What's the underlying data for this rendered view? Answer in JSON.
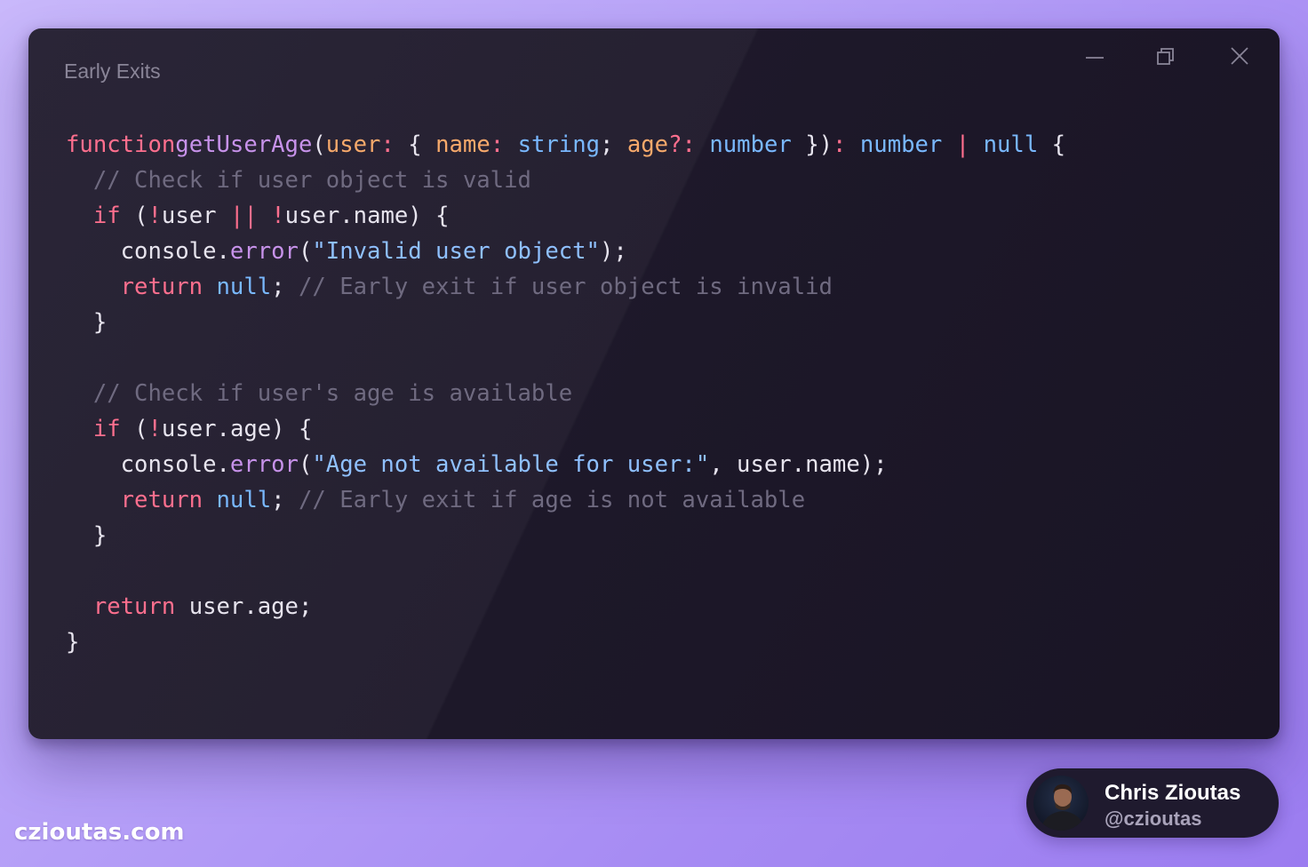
{
  "window": {
    "title": "Early Exits"
  },
  "code": {
    "lines": [
      [
        [
          "kw",
          "function"
        ],
        [
          "",
          ""
        ],
        [
          "fn",
          "getUserAge"
        ],
        [
          "",
          "("
        ],
        [
          "pr",
          "user"
        ],
        [
          "kw",
          ":"
        ],
        [
          "",
          " { "
        ],
        [
          "pr",
          "name"
        ],
        [
          "kw",
          ":"
        ],
        [
          "",
          " "
        ],
        [
          "ty",
          "string"
        ],
        [
          "",
          "; "
        ],
        [
          "pr",
          "age"
        ],
        [
          "kw",
          "?:"
        ],
        [
          "",
          " "
        ],
        [
          "ty",
          "number"
        ],
        [
          "",
          " })"
        ],
        [
          "kw",
          ":"
        ],
        [
          "",
          " "
        ],
        [
          "ty",
          "number"
        ],
        [
          "",
          " "
        ],
        [
          "kw",
          "|"
        ],
        [
          "",
          " "
        ],
        [
          "ty",
          "null"
        ],
        [
          "",
          " {"
        ]
      ],
      [
        [
          "",
          "  "
        ],
        [
          "cm",
          "// Check if user object is valid"
        ]
      ],
      [
        [
          "",
          "  "
        ],
        [
          "kw",
          "if"
        ],
        [
          "",
          " ("
        ],
        [
          "kw",
          "!"
        ],
        [
          "",
          "user "
        ],
        [
          "kw",
          "||"
        ],
        [
          "",
          " "
        ],
        [
          "kw",
          "!"
        ],
        [
          "",
          "user.name) {"
        ]
      ],
      [
        [
          "",
          "    console."
        ],
        [
          "fn",
          "error"
        ],
        [
          "",
          "("
        ],
        [
          "st",
          "\"Invalid user object\""
        ],
        [
          "",
          ");"
        ]
      ],
      [
        [
          "",
          "    "
        ],
        [
          "kw",
          "return"
        ],
        [
          "",
          " "
        ],
        [
          "ty",
          "null"
        ],
        [
          "",
          "; "
        ],
        [
          "cm",
          "// Early exit if user object is invalid"
        ]
      ],
      [
        [
          "",
          "  }"
        ]
      ],
      [
        [
          "",
          ""
        ]
      ],
      [
        [
          "",
          "  "
        ],
        [
          "cm",
          "// Check if user's age is available"
        ]
      ],
      [
        [
          "",
          "  "
        ],
        [
          "kw",
          "if"
        ],
        [
          "",
          " ("
        ],
        [
          "kw",
          "!"
        ],
        [
          "",
          "user.age) {"
        ]
      ],
      [
        [
          "",
          "    console."
        ],
        [
          "fn",
          "error"
        ],
        [
          "",
          "("
        ],
        [
          "st",
          "\"Age not available for user:\""
        ],
        [
          "",
          ", user.name);"
        ]
      ],
      [
        [
          "",
          "    "
        ],
        [
          "kw",
          "return"
        ],
        [
          "",
          " "
        ],
        [
          "ty",
          "null"
        ],
        [
          "",
          "; "
        ],
        [
          "cm",
          "// Early exit if age is not available"
        ]
      ],
      [
        [
          "",
          "  }"
        ]
      ],
      [
        [
          "",
          ""
        ]
      ],
      [
        [
          "",
          "  "
        ],
        [
          "kw",
          "return"
        ],
        [
          "",
          " user.age;"
        ]
      ],
      [
        [
          "",
          "}"
        ]
      ]
    ]
  },
  "site": {
    "url": "czioutas.com"
  },
  "profile": {
    "name": "Chris Zioutas",
    "handle": "@czioutas"
  },
  "icons": {
    "minimize": "minimize-icon",
    "maximize": "restore-icon",
    "close": "close-icon"
  },
  "colors": {
    "keyword": "#ff6f8e",
    "function": "#c792ea",
    "property": "#f7a96b",
    "type": "#79b8ff",
    "string": "#8fc0ff",
    "comment": "#6f6a80",
    "text": "#e7e4ee"
  }
}
